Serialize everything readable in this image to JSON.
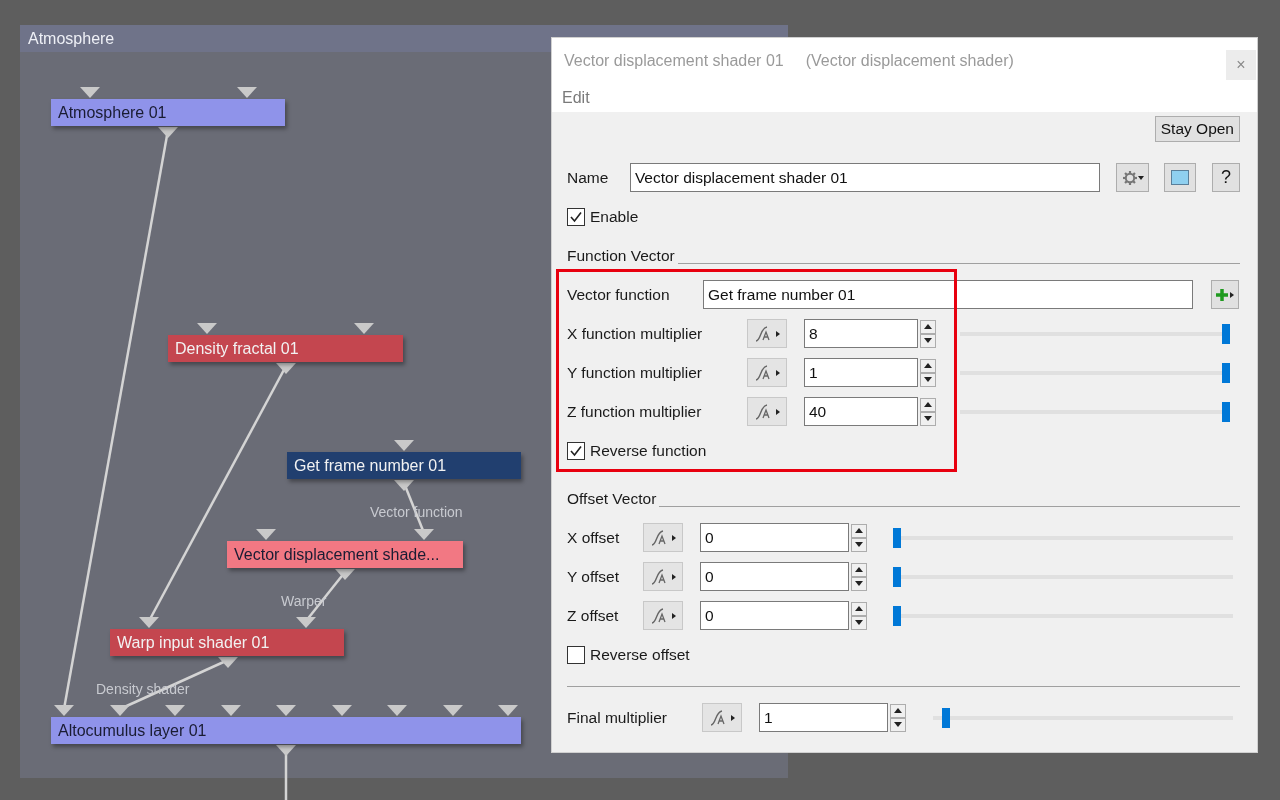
{
  "graph": {
    "title": "Atmosphere",
    "nodes": [
      {
        "label": "Atmosphere 01",
        "color": "#8f93ea"
      },
      {
        "label": "Density fractal 01",
        "color": "#c4464f"
      },
      {
        "label": "Get frame number 01",
        "color": "#213f6f"
      },
      {
        "label": "Vector displacement shade...",
        "color": "#f27883"
      },
      {
        "label": "Warp input shader 01",
        "color": "#c4464f"
      },
      {
        "label": "Altocumulus layer 01",
        "color": "#8f93ea"
      }
    ],
    "edge_labels": [
      "Vector function",
      "Warper",
      "Density shader"
    ]
  },
  "dialog": {
    "title": "Vector displacement shader 01",
    "subtitle": "(Vector displacement shader)",
    "close_button": "×",
    "menu": [
      "Edit"
    ],
    "stay_open_button": "Stay Open",
    "name": {
      "label": "Name",
      "value": "Vector displacement shader 01"
    },
    "help_button": "?",
    "enable": {
      "label": "Enable",
      "checked": true
    },
    "function_vector": {
      "heading": "Function Vector",
      "vector_function": {
        "label": "Vector function",
        "value": "Get frame number 01"
      },
      "multipliers": [
        {
          "label": "X function multiplier",
          "value": "8",
          "level": 1
        },
        {
          "label": "Y function multiplier",
          "value": "1",
          "level": 1
        },
        {
          "label": "Z function multiplier",
          "value": "40",
          "level": 1
        }
      ],
      "reverse": {
        "label": "Reverse function",
        "checked": true
      }
    },
    "offset_vector": {
      "heading": "Offset Vector",
      "offsets": [
        {
          "label": "X offset",
          "value": "0",
          "level": 0
        },
        {
          "label": "Y offset",
          "value": "0",
          "level": 0
        },
        {
          "label": "Z offset",
          "value": "0",
          "level": 0
        }
      ],
      "reverse": {
        "label": "Reverse offset",
        "checked": false
      }
    },
    "final_multiplier": {
      "label": "Final multiplier",
      "value": "1",
      "level": 0.03
    }
  }
}
